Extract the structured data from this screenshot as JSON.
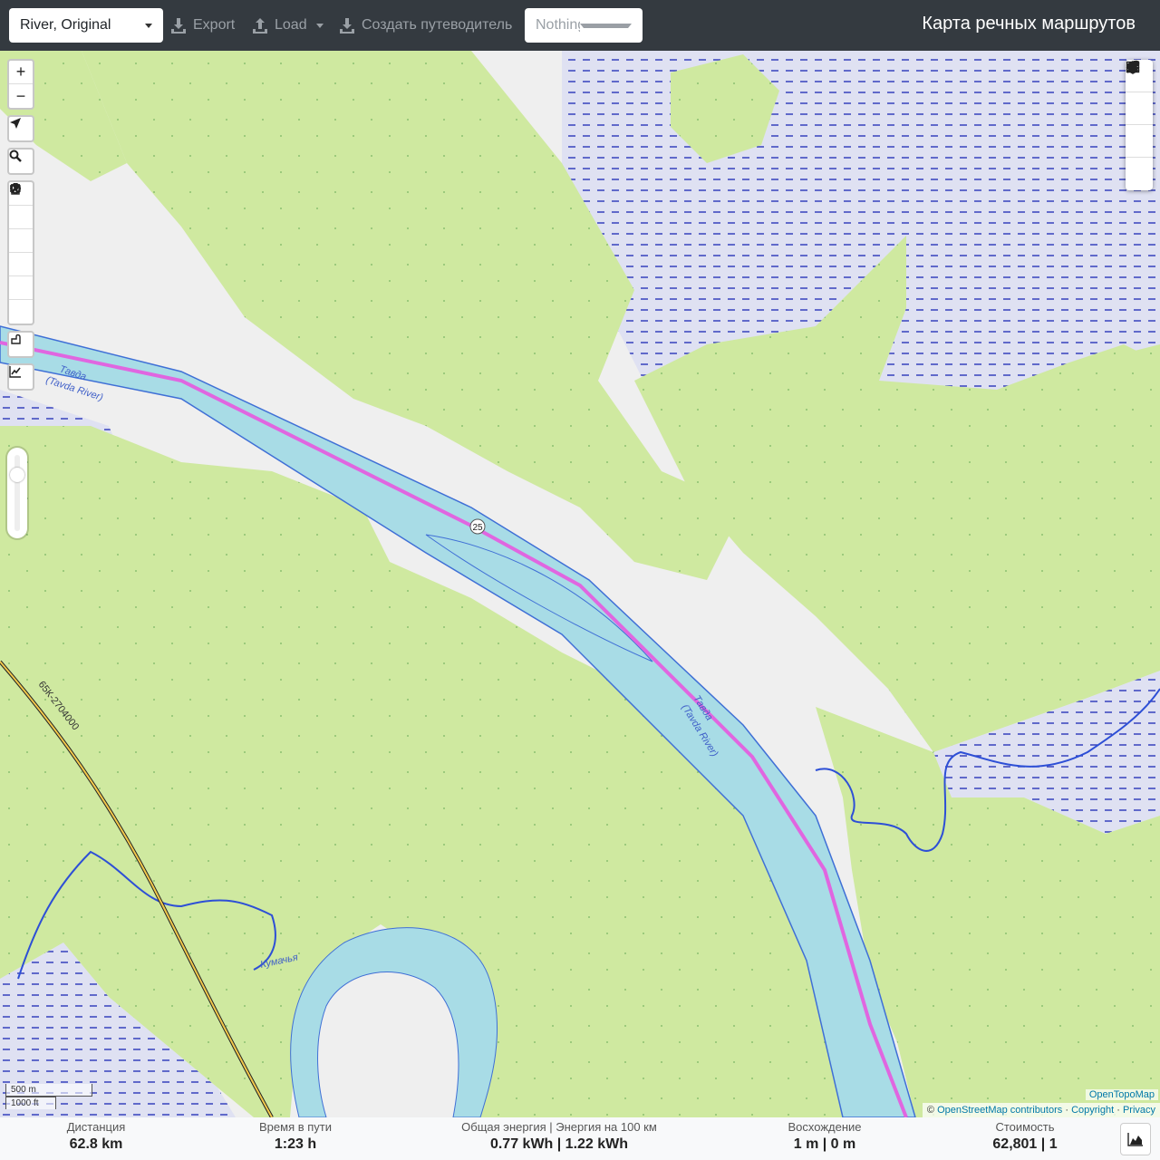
{
  "header": {
    "profile": "River, Original",
    "export_label": "Export",
    "load_label": "Load",
    "guide_label": "Создать путеводитель",
    "nothing_selected": "Nothing selected",
    "title": "Карта речных маршрутов"
  },
  "map_controls": {
    "zoom_in": "+",
    "zoom_out": "−"
  },
  "map_labels": {
    "river_ru": "Тавда",
    "river_en": "(Tavda River)",
    "route_marker": "25",
    "road_ref": "65К-2704000",
    "creek": "Кумачья"
  },
  "scale": {
    "metric": "500 m",
    "imperial": "1000 ft"
  },
  "attribution": {
    "tiles": "OpenTopoMap",
    "osm": "OpenStreetMap contributors",
    "copyright": "Copyright",
    "privacy": "Privacy"
  },
  "stats": {
    "distance_label": "Дистанция",
    "distance_value": "62.8 km",
    "time_label": "Время в пути",
    "time_value": "1:23 h",
    "energy_label": "Общая энергия | Энергия на 100 км",
    "energy_value": "0.77 kWh | 1.22 kWh",
    "ascent_label": "Восхождение",
    "ascent_value": "1 m | 0 m",
    "cost_label": "Стоимость",
    "cost_value": "62,801 | 1"
  },
  "colors": {
    "forest": "#cfe9a0",
    "wetland": "#dfe1f2",
    "water": "#a8dce6",
    "route": "#e066e0",
    "stream": "#2d4fd6",
    "navbar": "#343a40"
  }
}
